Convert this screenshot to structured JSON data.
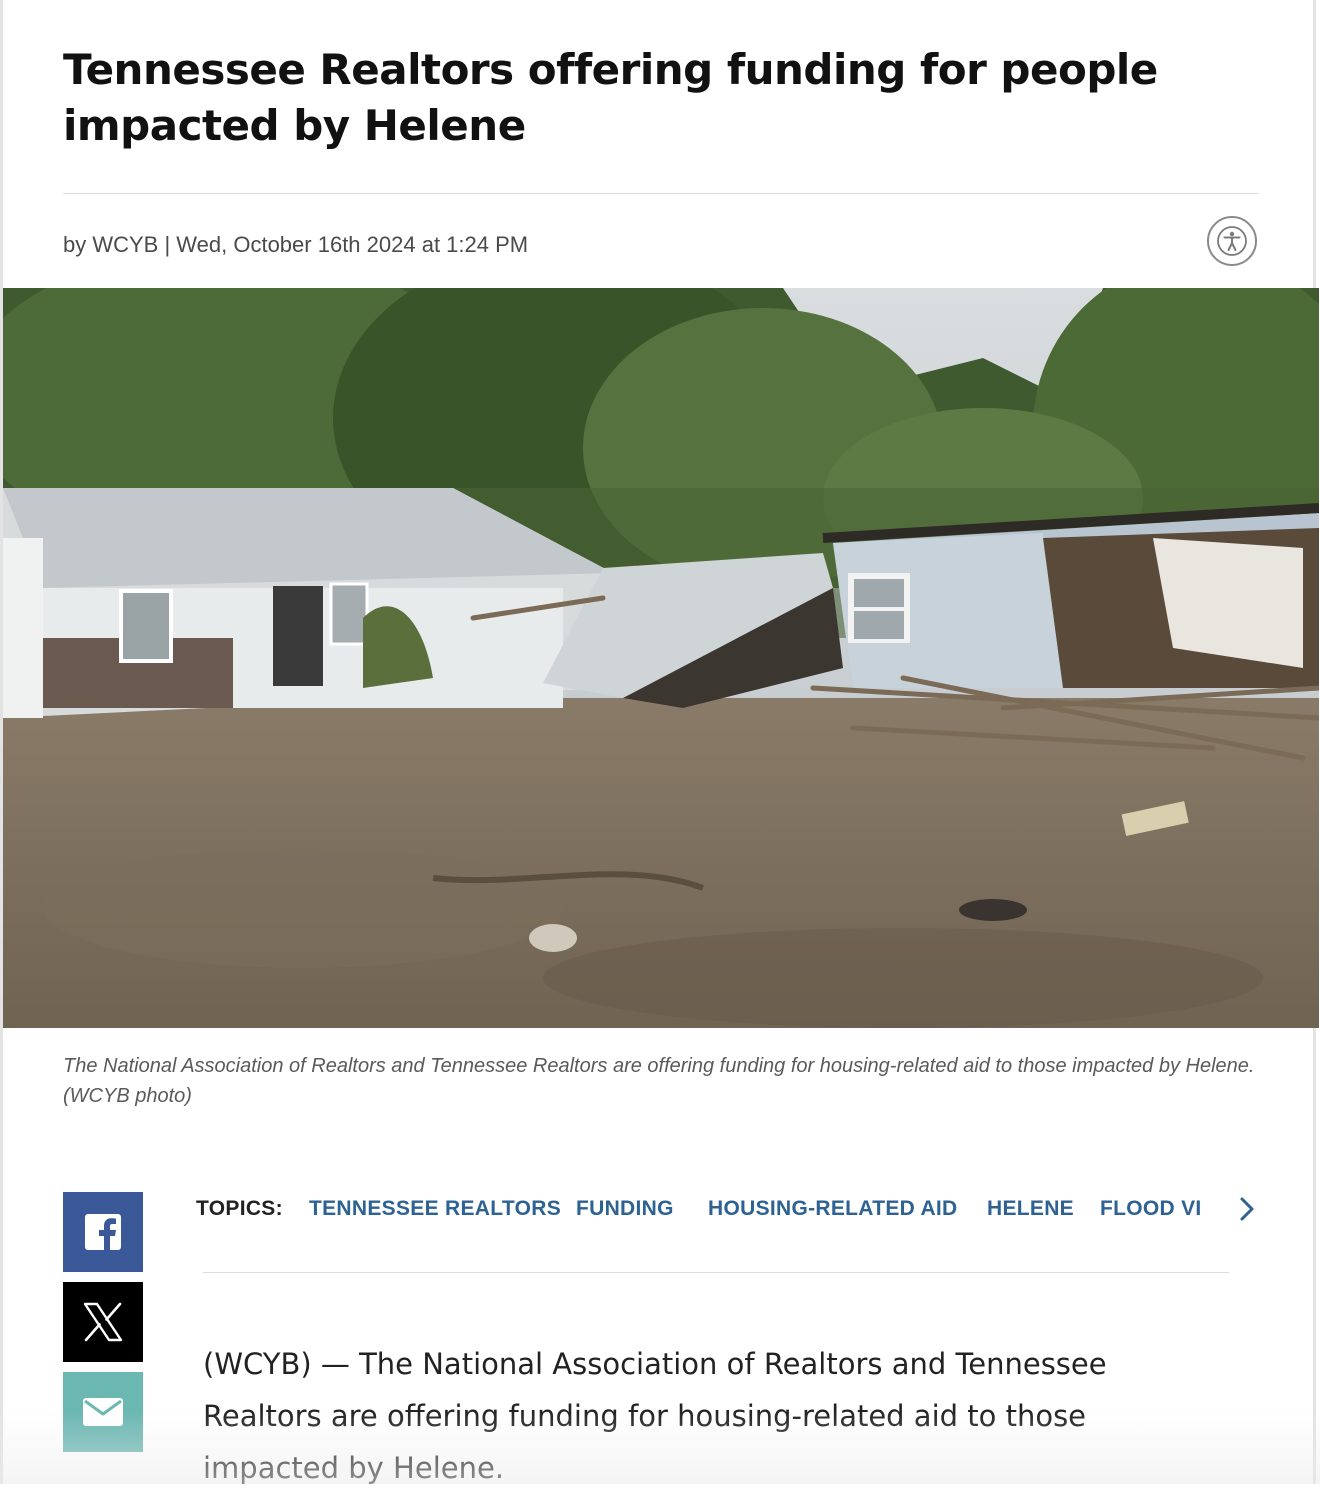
{
  "article": {
    "headline": "Tennessee Realtors offering funding for people impacted by Helene",
    "byline": "by WCYB | Wed, October 16th 2024 at 1:24 PM",
    "caption": "The National Association of Realtors and Tennessee Realtors are offering funding for housing-related aid to those impacted by Helene. (WCYB photo)",
    "body": "(WCYB) — The National Association of Realtors and Tennessee Realtors are offering funding for housing-related aid to those impacted by Helene."
  },
  "icons": {
    "accessibility": "accessibility-icon",
    "facebook": "facebook-icon",
    "x": "x-icon",
    "email": "mail-icon",
    "next": "chevron-right-icon"
  },
  "topics": {
    "label": "TOPICS:",
    "items": [
      "TENNESSEE REALTORS",
      "FUNDING",
      "HOUSING-RELATED AID",
      "HELENE",
      "FLOOD VI"
    ]
  },
  "colors": {
    "facebook": "#3b5998",
    "x": "#000000",
    "email": "#6bb7b2",
    "topic_link": "#2d6293"
  }
}
